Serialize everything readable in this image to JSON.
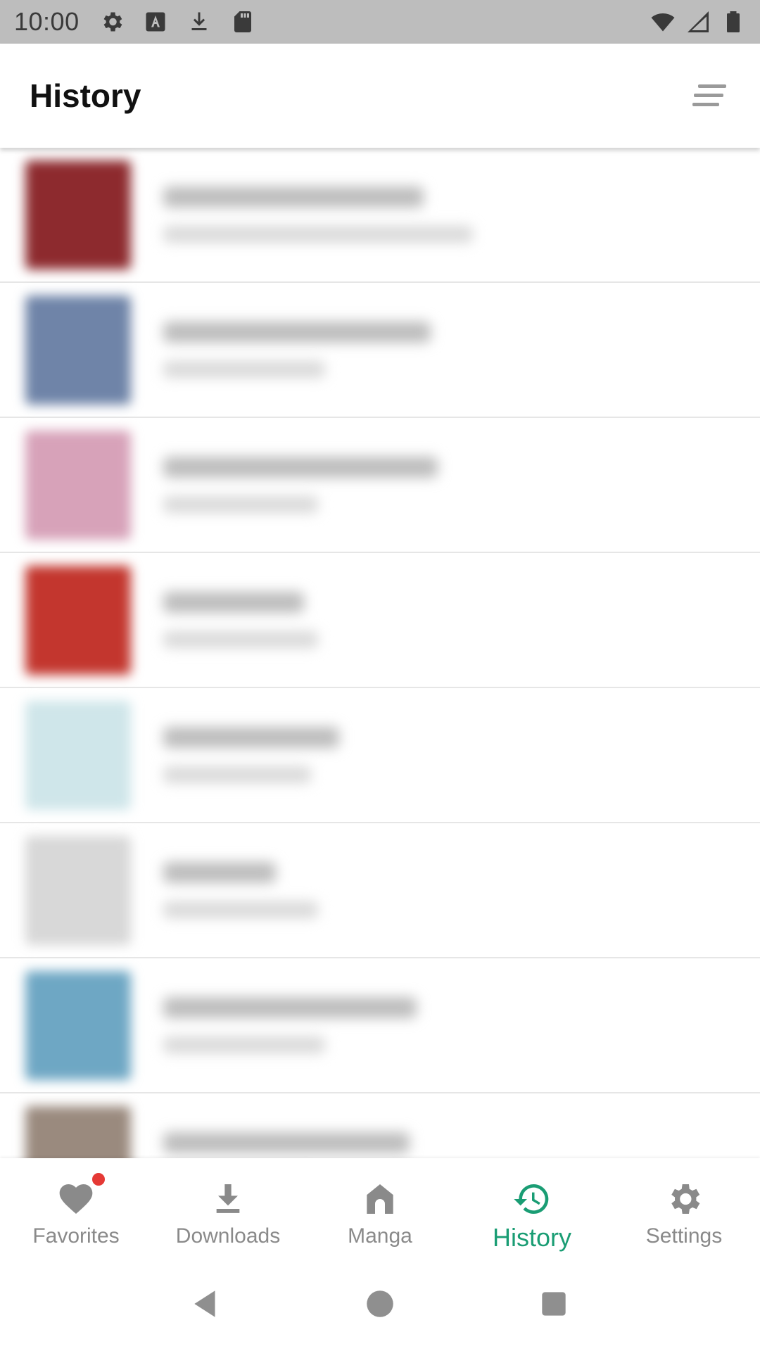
{
  "status_bar": {
    "time": "10:00",
    "left_icons": [
      "settings-icon",
      "text-a-icon",
      "download-icon",
      "sd-card-icon"
    ],
    "right_icons": [
      "wifi-icon",
      "cell-signal-icon",
      "battery-icon"
    ]
  },
  "app_bar": {
    "title": "History",
    "sort_icon": "sort-icon"
  },
  "history_items": [
    {
      "thumb_color": "#8d2a2e"
    },
    {
      "thumb_color": "#6f84a8"
    },
    {
      "thumb_color": "#d7a2b9"
    },
    {
      "thumb_color": "#c3362e"
    },
    {
      "thumb_color": "#cfe6ea"
    },
    {
      "thumb_color": "#d8d8d8"
    },
    {
      "thumb_color": "#6ea7c4"
    },
    {
      "thumb_color": "#9a8a7e"
    }
  ],
  "bottom_nav": {
    "active_color": "#1a9d74",
    "items": [
      {
        "label": "Favorites",
        "icon": "heart-icon",
        "badge": true
      },
      {
        "label": "Downloads",
        "icon": "download-icon",
        "badge": false
      },
      {
        "label": "Manga",
        "icon": "home-icon",
        "badge": false
      },
      {
        "label": "History",
        "icon": "history-icon",
        "badge": false,
        "active": true
      },
      {
        "label": "Settings",
        "icon": "gear-icon",
        "badge": false
      }
    ]
  },
  "system_nav": {
    "buttons": [
      "back-icon",
      "home-circle-icon",
      "recents-icon"
    ]
  }
}
